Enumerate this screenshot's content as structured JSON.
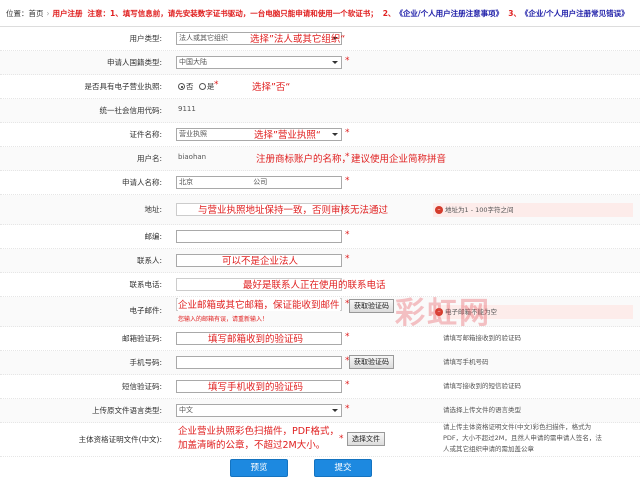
{
  "notice": {
    "position_label": "位置：",
    "home": "首页",
    "current": "用户注册",
    "warning": "注意：1、填写信息前，请先安装数字证书驱动，一台电脑只能申请和使用一个软证书；",
    "doc2_prefix": "2、",
    "doc2": "《企业/个人用户注册注意事项》",
    "doc3_prefix": "3、",
    "doc3": "《企业/个人用户注册常见错误》"
  },
  "rows": {
    "user_type": {
      "label": "用户类型:",
      "value": "法人或其它组织",
      "note": "选择”法人或其它组织“"
    },
    "nationality": {
      "label": "申请人国籍类型:",
      "value": "中国大陆"
    },
    "e_license": {
      "label": "是否具有电子营业执照:",
      "no": "否",
      "yes": "是",
      "note": "选择”否“"
    },
    "credit_code": {
      "label": "统一社会信用代码:",
      "value": "9111"
    },
    "cert_name": {
      "label": "证件名称:",
      "value": "营业执照",
      "note": "选择”营业执照“"
    },
    "username": {
      "label": "用户名:",
      "value": "biaohan",
      "note": "注册商标账户的名称，建议使用企业简称拼音"
    },
    "applicant": {
      "label": "申请人名称:",
      "value_prefix": "北京",
      "value_suffix": "公司"
    },
    "address": {
      "label": "地址:",
      "note": "与营业执照地址保持一致，否则审核无法通过",
      "hint": "地址为1 - 100字符之间"
    },
    "postcode": {
      "label": "邮编:"
    },
    "contact": {
      "label": "联系人:",
      "note": "可以不是企业法人"
    },
    "phone": {
      "label": "联系电话:",
      "note": "最好是联系人正在使用的联系电话"
    },
    "email": {
      "label": "电子邮件:",
      "note": "企业邮箱或其它邮箱，保证能收到邮件",
      "button": "获取验证码",
      "sub_error": "您输入的邮箱有误，请重新输入！",
      "hint": "电子邮箱不能为空"
    },
    "email_code": {
      "label": "邮箱验证码:",
      "note": "填写邮箱收到的验证码",
      "hint": "请填写邮箱接收到的验证码"
    },
    "mobile": {
      "label": "手机号码:",
      "button": "获取验证码",
      "hint": "请填写手机号码"
    },
    "sms_code": {
      "label": "短信验证码:",
      "note": "填写手机收到的验证码",
      "hint": "请填写接收到的短信验证码"
    },
    "doc_language": {
      "label": "上传原文件语言类型:",
      "value": "中文",
      "hint": "请选择上传文件的语言类型"
    },
    "cert_file": {
      "label": "主体资格证明文件(中文):",
      "note1": "企业营业执照彩色扫描件，PDF格式，",
      "note2": "加盖清晰的公章，不超过2M大小。",
      "button": "选择文件",
      "hint1": "请上传主体资格证明文件(中文)彩色扫描件，格式为",
      "hint2": "PDF，大小不超过2M，且然人申请的需申请人签名，法",
      "hint3": "人或其它组织申请的需加盖公章"
    }
  },
  "actions": {
    "preview": "预览",
    "submit": "提交"
  },
  "watermark": "彩虹网"
}
